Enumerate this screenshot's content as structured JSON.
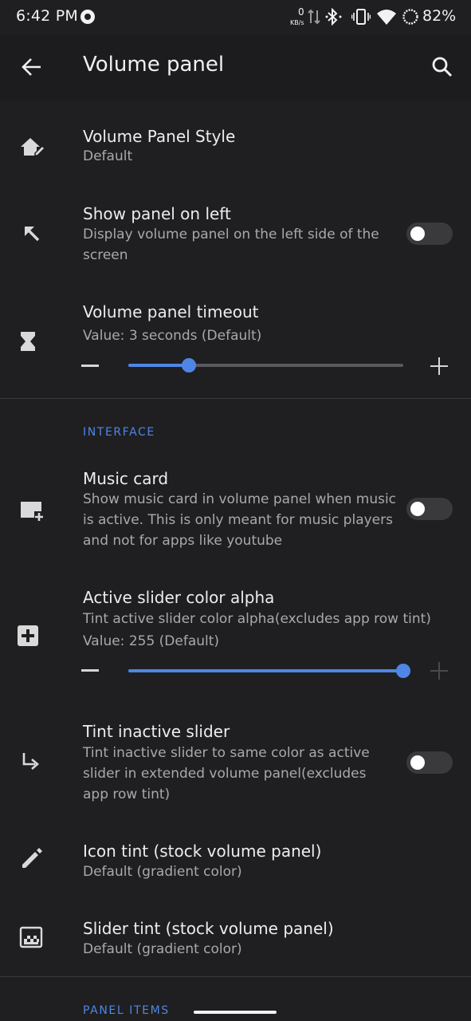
{
  "status_bar": {
    "time": "6:42 PM",
    "net_speed_value": "0",
    "net_speed_unit": "KB/s",
    "battery": "82%"
  },
  "app_bar": {
    "title": "Volume panel",
    "back_icon": "arrow-back-icon",
    "search_icon": "search-icon"
  },
  "items": {
    "panel_style": {
      "title": "Volume Panel Style",
      "summary": "Default",
      "icon": "home-edit-icon"
    },
    "show_left": {
      "title": "Show panel on left",
      "summary": "Display volume panel on the left side of the screen",
      "icon": "arrow-up-left-icon",
      "enabled": false
    },
    "timeout": {
      "title": "Volume panel timeout",
      "value_text": "Value: 3 seconds (Default)",
      "icon": "hourglass-icon",
      "level": 0.22
    },
    "music_card": {
      "title": "Music card",
      "summary": "Show music card in volume panel when music is active. This is only meant for music players and not for apps like youtube",
      "icon": "add-card-icon",
      "enabled": false
    },
    "alpha": {
      "title": "Active slider color alpha",
      "summary": "Tint active slider color alpha(excludes app row tint)",
      "value_text": "Value: 255  (Default)",
      "icon": "plus-box-icon",
      "level": 1.0
    },
    "tint_inactive": {
      "title": "Tint inactive slider",
      "summary": "Tint inactive slider to same color as active slider in extended volume panel(excludes app row tint)",
      "icon": "subdirectory-arrow-icon",
      "enabled": false
    },
    "icon_tint": {
      "title": "Icon tint (stock volume panel)",
      "summary": "Default (gradient color)",
      "icon": "pencil-icon"
    },
    "slider_tint": {
      "title": "Slider tint (stock volume panel)",
      "summary": "Default (gradient color)",
      "icon": "checkerboard-icon"
    }
  },
  "sections": {
    "interface": "INTERFACE",
    "panel_items": "PANEL ITEMS"
  },
  "colors": {
    "accent": "#4f86e6",
    "background": "#1f1f21",
    "toggle_off": "#3a3a3d"
  }
}
